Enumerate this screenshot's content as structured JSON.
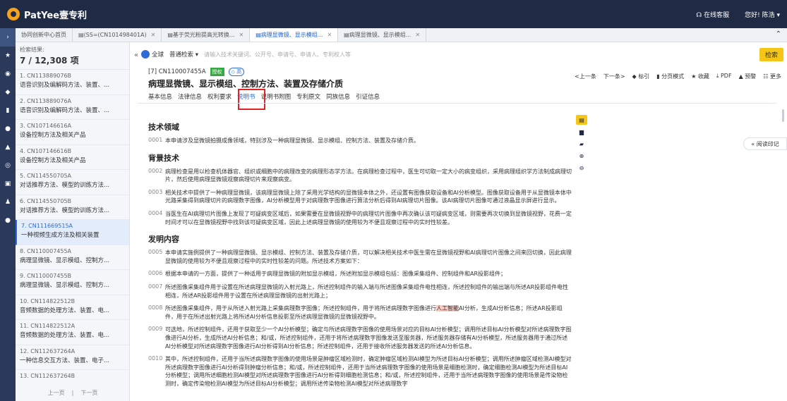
{
  "brand": {
    "name": "PatYee壹专利"
  },
  "topbar": {
    "service": "在线客服",
    "user": "您好! 陈浩 ▾"
  },
  "tabs": [
    {
      "label": "协同创新中心首页",
      "active": false
    },
    {
      "label": "(SS=(CN101498401A)",
      "active": false
    },
    {
      "label": "基于荧光粉提高光转换...",
      "active": false
    },
    {
      "label": "病理显微镜、显示模组...",
      "active": true
    },
    {
      "label": "病理显微镜、显示模组...",
      "active": false
    }
  ],
  "results": {
    "label": "检索结果:",
    "count": "7 / 12,308 项",
    "items": [
      {
        "num": "1. CN113889076B",
        "title": "语音识别及编解码方法、装置、..."
      },
      {
        "num": "2. CN113889076A",
        "title": "语音识别及编解码方法、装置、..."
      },
      {
        "num": "3. CN107146616A",
        "title": "设备控制方法及相关产品"
      },
      {
        "num": "4. CN107146616B",
        "title": "设备控制方法及相关产品"
      },
      {
        "num": "5. CN114550705A",
        "title": "对话推荐方法、模型的训练方法..."
      },
      {
        "num": "6. CN114550705B",
        "title": "对话推荐方法、模型的训练方法..."
      },
      {
        "num": "7. CN111669515A",
        "title": "一种视频生成方法及相关装置"
      },
      {
        "num": "8. CN110007455A",
        "title": "病理显微镜、显示模组、控制方..."
      },
      {
        "num": "9. CN110007455B",
        "title": "病理显微镜、显示模组、控制方..."
      },
      {
        "num": "10. CN114822512B",
        "title": "音频数据的处理方法、装置、电..."
      },
      {
        "num": "11. CN114822512A",
        "title": "音频数据的处理方法、装置、电..."
      },
      {
        "num": "12. CN112637264A",
        "title": "一种信息交互方法、装置、电子..."
      },
      {
        "num": "13. CN112637264B",
        "title": ""
      }
    ],
    "prev": "上一页",
    "next": "下一页"
  },
  "search": {
    "scope": "全球",
    "mode": "普通检索 ▾",
    "placeholder": "请输入技术关键词、公开号、申请号、申请人、专利权人等",
    "button": "检索"
  },
  "document": {
    "number": "[7] CN110007455A",
    "status_badge": "授权",
    "value_badge": "高",
    "title": "病理显微镜、显示模组、控制方法、装置及存储介质",
    "nav": [
      "基本信息",
      "法律信息",
      "权利要求",
      "说明书",
      "说明书附图",
      "专利原文",
      "同族信息",
      "引证信息"
    ],
    "nav_active_index": 3,
    "toolbar": [
      "<上一条",
      "下一条>",
      "◆ 标引",
      "▮ 分页模式",
      "★ 收藏",
      "⤓ PDF",
      "▲ 预警",
      "☷ 更多"
    ],
    "read_mark": "« 阅读印记"
  },
  "content": {
    "sections": [
      {
        "heading": "技术领域",
        "paras": [
          {
            "n": "0001",
            "t": "本申请涉及显微镜拍摄成像领域，特别涉及一种病理显微镜、显示模组、控制方法、装置及存储介质。"
          }
        ]
      },
      {
        "heading": "背景技术",
        "paras": [
          {
            "n": "0002",
            "t": "病理检查是用以检查机体器官、组织或细胞中的病理改变的病理形态学方法。在病理检查过程中，医生可切取一定大小的病变组织，采用病理组织学方法制成病理切片，然后使用病理显微镜观察病理切片来观察病变。"
          },
          {
            "n": "0003",
            "t": "相关技术中提供了一种病理显微镜，该病理显微镜上除了采用光学结构的显微镜本体之外，还设置有图像获取设备和AI分析模型。图像获取设备用于从显微镜本体中光路采集得到病理切片的病理数字图像，AI分析模型用于对病理数字图像进行算法分析后得到AI病理切片图像。该AI病理切片图像可通过液晶显示屏进行显示。"
          },
          {
            "n": "0004",
            "t": "当医生在AI病理切片图像上发现了可疑病变区域后，如果需要在显微镜视野中的病理切片图像中再次确认该可疑病变区域，则需要再次切换到显微镜视野，花费一定时间才可以在显微镜视野中找到该可疑病变区域，因此上述病理显微镜的使用较为不便且观察过程中的实时性较差。"
          }
        ]
      },
      {
        "heading": "发明内容",
        "paras": [
          {
            "n": "0005",
            "t": "本申请实施例提供了一种病理显微镜、显示模组、控制方法、装置及存储介质，可以解决相关技术中医生需在显微镜视野和AI病理切片图像之间来回切换，因此病理显微镜的使用较为不便且观察过程中的实时性较差的问题。所述技术方案如下："
          },
          {
            "n": "0006",
            "t": "根据本申请的一方面，提供了一种适用于病理显微镜的附加显示模组，所述附加显示模组包括：图像采集组件、控制组件和AR投影组件；"
          },
          {
            "n": "0007",
            "t": "所述图像采集组件用于设置在所述病理显微镜的入射光路上，所述控制组件的输入端与所述图像采集组件电性相连，所述控制组件的输出端与所述AR投影组件电性相连，所述AR投影组件用于设置在所述病理显微镜的出射光路上；"
          },
          {
            "n": "0008",
            "t": "所述图像采集组件，用于从所述入射光路上采集病理数字图像；所述控制组件，用于将所述病理数字图像进行",
            "hl": "人工智能",
            "t2": "AI分析，生成AI分析信息；所述AR投影组件，用于在所述出射光路上将所述AI分析信息投影至所述病理显微镜的显微镜视野中。"
          },
          {
            "n": "0009",
            "t": "可选地，所述控制组件，还用于获取至少一个AI分析模型；确定与所述病理数字图像的使用场景对应的目标AI分析模型；调用所述目标AI分析模型对所述病理数字图像进行AI分析，生成所述AI分析信息；和/或，所述控制组件，还用于将所述病理数字图像发送至服务器，所述服务器存储有AI分析模型，所述服务器用于通过所述AI分析模型对所述病理数字图像进行AI分析得到AI分析信息；所述控制组件，还用于接收所述服务器发送的所述AI分析信息。"
          },
          {
            "n": "0010",
            "t": "其中，所述控制组件，还用于当所述病理数字图像的使用场景是肿瘤区域检测时，确定肿瘤区域检测AI模型为所述目标AI分析模型；调用所述肿瘤区域检测AI模型对所述病理数字图像进行AI分析得到肿瘤分析信息；和/或，所述控制组件，还用于当所述病理数字图像的使用场景是细胞检测时，确定细胞检测AI模型为所述目标AI分析模型；调用所述细胞检测AI模型对所述病理数字图像进行AI分析得到细胞检测信息；和/或，所述控制组件，还用于当所述病理数字图像的使用场景是传染物检测时，确定传染物检测AI模型为所述目标AI分析模型；调用所述传染物检测AI模型对所述病理数字"
          }
        ]
      }
    ]
  }
}
